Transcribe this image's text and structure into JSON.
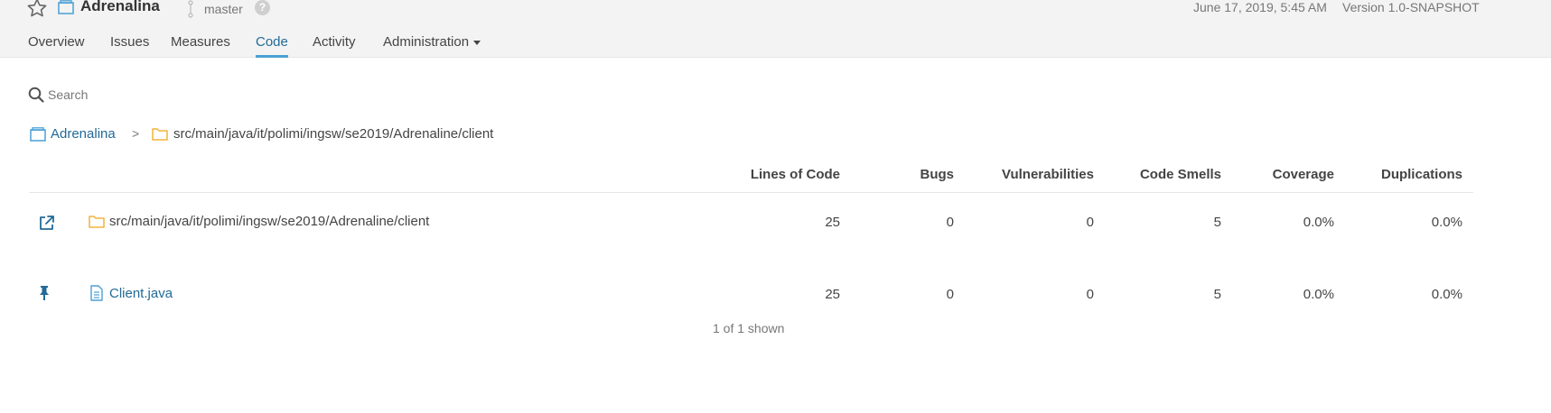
{
  "header": {
    "project_name": "Adrenalina",
    "branch": "master",
    "help": "?",
    "date": "June 17, 2019, 5:45 AM",
    "version": "Version 1.0-SNAPSHOT"
  },
  "nav": {
    "tabs": [
      {
        "label": "Overview",
        "active": false
      },
      {
        "label": "Issues",
        "active": false
      },
      {
        "label": "Measures",
        "active": false
      },
      {
        "label": "Code",
        "active": true
      },
      {
        "label": "Activity",
        "active": false
      },
      {
        "label": "Administration",
        "active": false
      }
    ]
  },
  "search": {
    "placeholder": "Search"
  },
  "breadcrumb": {
    "project": "Adrenalina",
    "separator": ">",
    "path": "src/main/java/it/polimi/ingsw/se2019/Adrenaline/client"
  },
  "table": {
    "columns": [
      "Lines of Code",
      "Bugs",
      "Vulnerabilities",
      "Code Smells",
      "Coverage",
      "Duplications"
    ],
    "rows": [
      {
        "icon": "external-link-icon",
        "type_icon": "folder-icon",
        "name": "src/main/java/it/polimi/ingsw/se2019/Adrenaline/client",
        "values": [
          "25",
          "0",
          "0",
          "5",
          "0.0%",
          "0.0%"
        ]
      },
      {
        "icon": "pin-icon",
        "type_icon": "file-icon",
        "name": "Client.java",
        "values": [
          "25",
          "0",
          "0",
          "5",
          "0.0%",
          "0.0%"
        ]
      }
    ],
    "footer": "1 of 1 shown"
  },
  "colors": {
    "link": "#236a97",
    "accent": "#4b9fd5",
    "folder": "#f0b43c",
    "topbar": "#f3f3f3"
  }
}
